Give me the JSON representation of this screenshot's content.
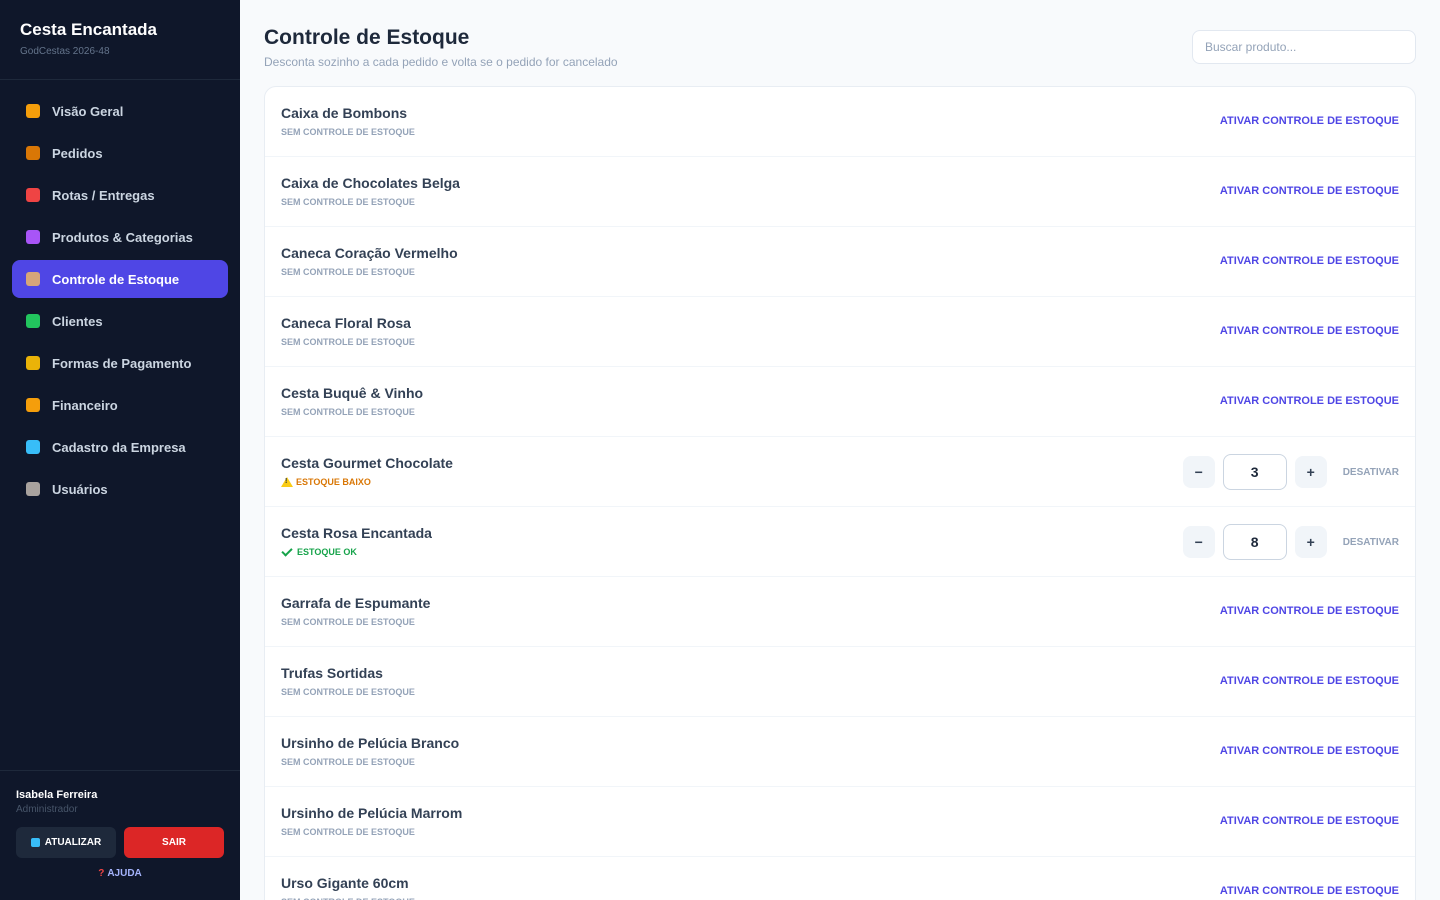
{
  "sidebar": {
    "brand_title": "Cesta Encantada",
    "brand_sub": "GodCestas 2026-48",
    "items": [
      {
        "label": "Visão Geral",
        "icon": "bar-chart-icon",
        "color": "#f59e0b",
        "active": false
      },
      {
        "label": "Pedidos",
        "icon": "box-icon",
        "color": "#d97706",
        "active": false
      },
      {
        "label": "Rotas / Entregas",
        "icon": "truck-icon",
        "color": "#ef4444",
        "active": false
      },
      {
        "label": "Produtos & Categorias",
        "icon": "shopping-bags-icon",
        "color": "#a855f7",
        "active": false
      },
      {
        "label": "Controle de Estoque",
        "icon": "package-icon",
        "color": "#d6a57a",
        "active": true
      },
      {
        "label": "Clientes",
        "icon": "people-icon",
        "color": "#22c55e",
        "active": false
      },
      {
        "label": "Formas de Pagamento",
        "icon": "credit-card-icon",
        "color": "#eab308",
        "active": false
      },
      {
        "label": "Financeiro",
        "icon": "money-bag-icon",
        "color": "#f59e0b",
        "active": false
      },
      {
        "label": "Cadastro da Empresa",
        "icon": "office-building-icon",
        "color": "#38bdf8",
        "active": false
      },
      {
        "label": "Usuários",
        "icon": "user-icon",
        "color": "#a8a29e",
        "active": false
      }
    ],
    "user_name": "Isabela Ferreira",
    "user_role": "Administrador",
    "refresh_label": "ATUALIZAR",
    "logout_label": "SAIR",
    "help_label": "AJUDA"
  },
  "header": {
    "title": "Controle de Estoque",
    "subtitle": "Desconta sozinho a cada pedido e volta se o pedido for cancelado",
    "search_placeholder": "Buscar produto..."
  },
  "labels": {
    "activate": "ATIVAR CONTROLE DE ESTOQUE",
    "deactivate": "DESATIVAR",
    "minus": "−",
    "plus": "+"
  },
  "products": [
    {
      "name": "Caixa de Bombons",
      "status": "SEM CONTROLE DE ESTOQUE",
      "tracked": false
    },
    {
      "name": "Caixa de Chocolates Belga",
      "status": "SEM CONTROLE DE ESTOQUE",
      "tracked": false
    },
    {
      "name": "Caneca Coração Vermelho",
      "status": "SEM CONTROLE DE ESTOQUE",
      "tracked": false
    },
    {
      "name": "Caneca Floral Rosa",
      "status": "SEM CONTROLE DE ESTOQUE",
      "tracked": false
    },
    {
      "name": "Cesta Buquê & Vinho",
      "status": "SEM CONTROLE DE ESTOQUE",
      "tracked": false
    },
    {
      "name": "Cesta Gourmet Chocolate",
      "status": "ESTOQUE BAIXO",
      "tracked": true,
      "level": "low",
      "qty": "3"
    },
    {
      "name": "Cesta Rosa Encantada",
      "status": "ESTOQUE OK",
      "tracked": true,
      "level": "ok",
      "qty": "8"
    },
    {
      "name": "Garrafa de Espumante",
      "status": "SEM CONTROLE DE ESTOQUE",
      "tracked": false
    },
    {
      "name": "Trufas Sortidas",
      "status": "SEM CONTROLE DE ESTOQUE",
      "tracked": false
    },
    {
      "name": "Ursinho de Pelúcia Branco",
      "status": "SEM CONTROLE DE ESTOQUE",
      "tracked": false
    },
    {
      "name": "Ursinho de Pelúcia Marrom",
      "status": "SEM CONTROLE DE ESTOQUE",
      "tracked": false
    },
    {
      "name": "Urso Gigante 60cm",
      "status": "SEM CONTROLE DE ESTOQUE",
      "tracked": false
    }
  ]
}
